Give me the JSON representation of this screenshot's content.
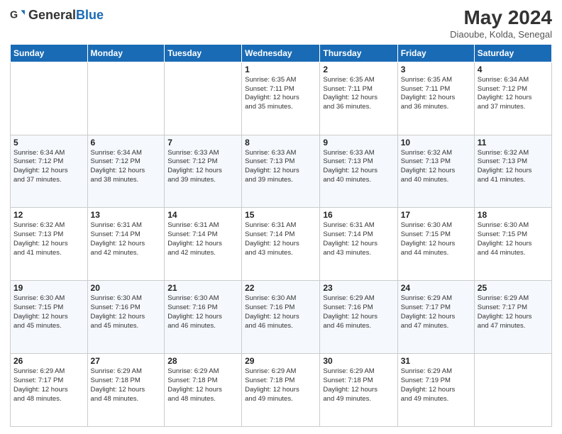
{
  "header": {
    "logo_general": "General",
    "logo_blue": "Blue",
    "month_title": "May 2024",
    "location": "Diaoube, Kolda, Senegal"
  },
  "days_of_week": [
    "Sunday",
    "Monday",
    "Tuesday",
    "Wednesday",
    "Thursday",
    "Friday",
    "Saturday"
  ],
  "weeks": [
    [
      {
        "day": "",
        "info": ""
      },
      {
        "day": "",
        "info": ""
      },
      {
        "day": "",
        "info": ""
      },
      {
        "day": "1",
        "info": "Sunrise: 6:35 AM\nSunset: 7:11 PM\nDaylight: 12 hours\nand 35 minutes."
      },
      {
        "day": "2",
        "info": "Sunrise: 6:35 AM\nSunset: 7:11 PM\nDaylight: 12 hours\nand 36 minutes."
      },
      {
        "day": "3",
        "info": "Sunrise: 6:35 AM\nSunset: 7:11 PM\nDaylight: 12 hours\nand 36 minutes."
      },
      {
        "day": "4",
        "info": "Sunrise: 6:34 AM\nSunset: 7:12 PM\nDaylight: 12 hours\nand 37 minutes."
      }
    ],
    [
      {
        "day": "5",
        "info": "Sunrise: 6:34 AM\nSunset: 7:12 PM\nDaylight: 12 hours\nand 37 minutes."
      },
      {
        "day": "6",
        "info": "Sunrise: 6:34 AM\nSunset: 7:12 PM\nDaylight: 12 hours\nand 38 minutes."
      },
      {
        "day": "7",
        "info": "Sunrise: 6:33 AM\nSunset: 7:12 PM\nDaylight: 12 hours\nand 39 minutes."
      },
      {
        "day": "8",
        "info": "Sunrise: 6:33 AM\nSunset: 7:13 PM\nDaylight: 12 hours\nand 39 minutes."
      },
      {
        "day": "9",
        "info": "Sunrise: 6:33 AM\nSunset: 7:13 PM\nDaylight: 12 hours\nand 40 minutes."
      },
      {
        "day": "10",
        "info": "Sunrise: 6:32 AM\nSunset: 7:13 PM\nDaylight: 12 hours\nand 40 minutes."
      },
      {
        "day": "11",
        "info": "Sunrise: 6:32 AM\nSunset: 7:13 PM\nDaylight: 12 hours\nand 41 minutes."
      }
    ],
    [
      {
        "day": "12",
        "info": "Sunrise: 6:32 AM\nSunset: 7:13 PM\nDaylight: 12 hours\nand 41 minutes."
      },
      {
        "day": "13",
        "info": "Sunrise: 6:31 AM\nSunset: 7:14 PM\nDaylight: 12 hours\nand 42 minutes."
      },
      {
        "day": "14",
        "info": "Sunrise: 6:31 AM\nSunset: 7:14 PM\nDaylight: 12 hours\nand 42 minutes."
      },
      {
        "day": "15",
        "info": "Sunrise: 6:31 AM\nSunset: 7:14 PM\nDaylight: 12 hours\nand 43 minutes."
      },
      {
        "day": "16",
        "info": "Sunrise: 6:31 AM\nSunset: 7:14 PM\nDaylight: 12 hours\nand 43 minutes."
      },
      {
        "day": "17",
        "info": "Sunrise: 6:30 AM\nSunset: 7:15 PM\nDaylight: 12 hours\nand 44 minutes."
      },
      {
        "day": "18",
        "info": "Sunrise: 6:30 AM\nSunset: 7:15 PM\nDaylight: 12 hours\nand 44 minutes."
      }
    ],
    [
      {
        "day": "19",
        "info": "Sunrise: 6:30 AM\nSunset: 7:15 PM\nDaylight: 12 hours\nand 45 minutes."
      },
      {
        "day": "20",
        "info": "Sunrise: 6:30 AM\nSunset: 7:16 PM\nDaylight: 12 hours\nand 45 minutes."
      },
      {
        "day": "21",
        "info": "Sunrise: 6:30 AM\nSunset: 7:16 PM\nDaylight: 12 hours\nand 46 minutes."
      },
      {
        "day": "22",
        "info": "Sunrise: 6:30 AM\nSunset: 7:16 PM\nDaylight: 12 hours\nand 46 minutes."
      },
      {
        "day": "23",
        "info": "Sunrise: 6:29 AM\nSunset: 7:16 PM\nDaylight: 12 hours\nand 46 minutes."
      },
      {
        "day": "24",
        "info": "Sunrise: 6:29 AM\nSunset: 7:17 PM\nDaylight: 12 hours\nand 47 minutes."
      },
      {
        "day": "25",
        "info": "Sunrise: 6:29 AM\nSunset: 7:17 PM\nDaylight: 12 hours\nand 47 minutes."
      }
    ],
    [
      {
        "day": "26",
        "info": "Sunrise: 6:29 AM\nSunset: 7:17 PM\nDaylight: 12 hours\nand 48 minutes."
      },
      {
        "day": "27",
        "info": "Sunrise: 6:29 AM\nSunset: 7:18 PM\nDaylight: 12 hours\nand 48 minutes."
      },
      {
        "day": "28",
        "info": "Sunrise: 6:29 AM\nSunset: 7:18 PM\nDaylight: 12 hours\nand 48 minutes."
      },
      {
        "day": "29",
        "info": "Sunrise: 6:29 AM\nSunset: 7:18 PM\nDaylight: 12 hours\nand 49 minutes."
      },
      {
        "day": "30",
        "info": "Sunrise: 6:29 AM\nSunset: 7:18 PM\nDaylight: 12 hours\nand 49 minutes."
      },
      {
        "day": "31",
        "info": "Sunrise: 6:29 AM\nSunset: 7:19 PM\nDaylight: 12 hours\nand 49 minutes."
      },
      {
        "day": "",
        "info": ""
      }
    ]
  ]
}
